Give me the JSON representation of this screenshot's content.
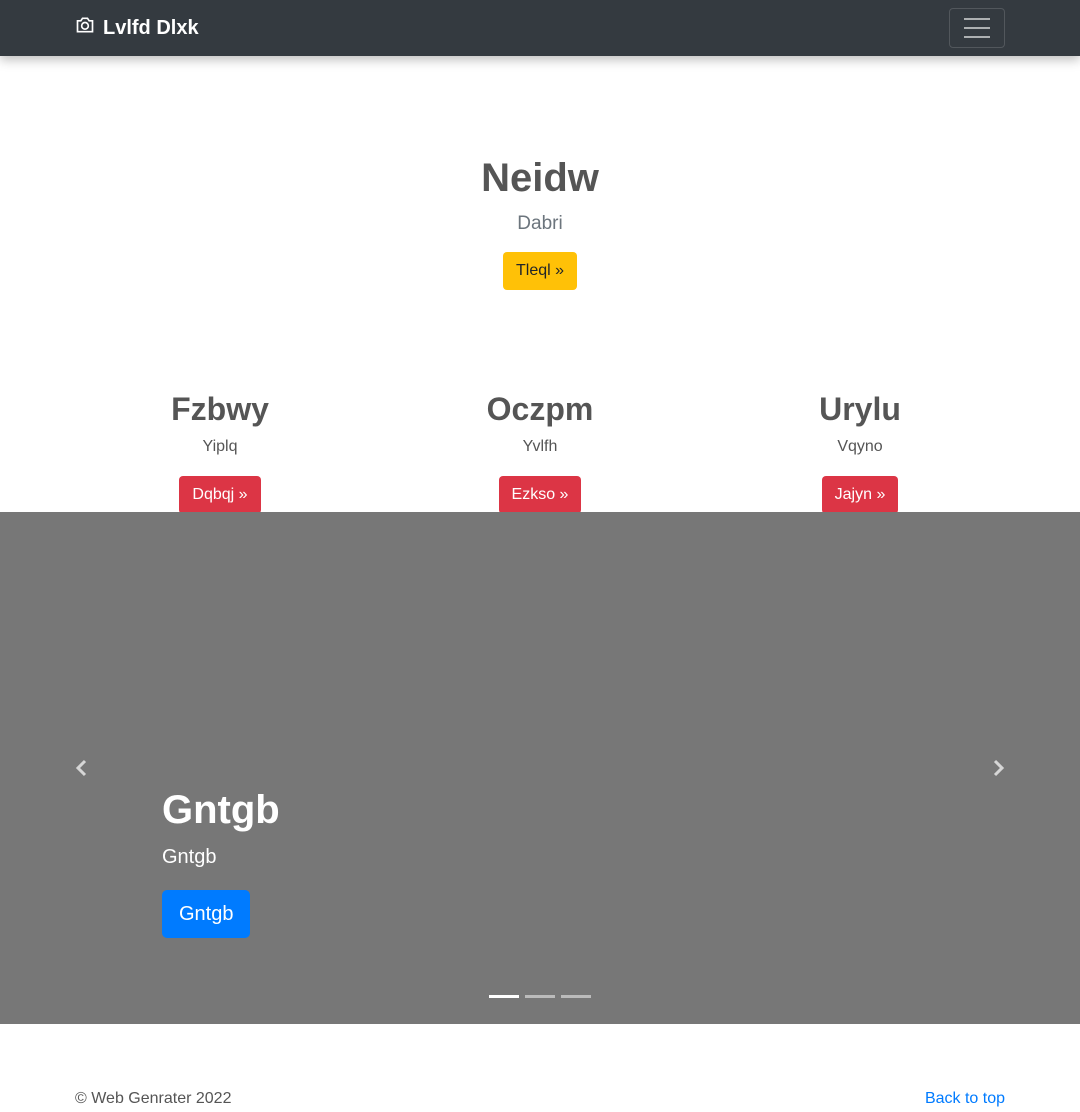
{
  "navbar": {
    "brand_icon": "camera-icon",
    "brand": "Lvlfd Dlxk",
    "toggler_icon": "hamburger-menu-icon"
  },
  "hero": {
    "title": "Neidw",
    "subtitle": "Dabri",
    "button": "Tleql »",
    "button_color": "#ffc107"
  },
  "features": [
    {
      "title": "Fzbwy",
      "text": "Yiplq",
      "button": "Dqbqj »"
    },
    {
      "title": "Oczpm",
      "text": "Yvlfh",
      "button": "Ezkso »"
    },
    {
      "title": "Urylu",
      "text": "Vqyno",
      "button": "Jajyn »"
    }
  ],
  "carousel": {
    "background_color": "#777777",
    "prev_icon": "chevron-left-icon",
    "next_icon": "chevron-right-icon",
    "slide": {
      "title": "Gntgb",
      "text": "Gntgb",
      "button": "Gntgb"
    },
    "indicator_count": 3,
    "active_index": 0
  },
  "footer": {
    "copyright": "© Web Genrater 2022",
    "back_to_top": "Back to top"
  },
  "colors": {
    "navbar": "#343a40",
    "danger": "#dc3545",
    "primary": "#007bff",
    "warning": "#ffc107"
  }
}
